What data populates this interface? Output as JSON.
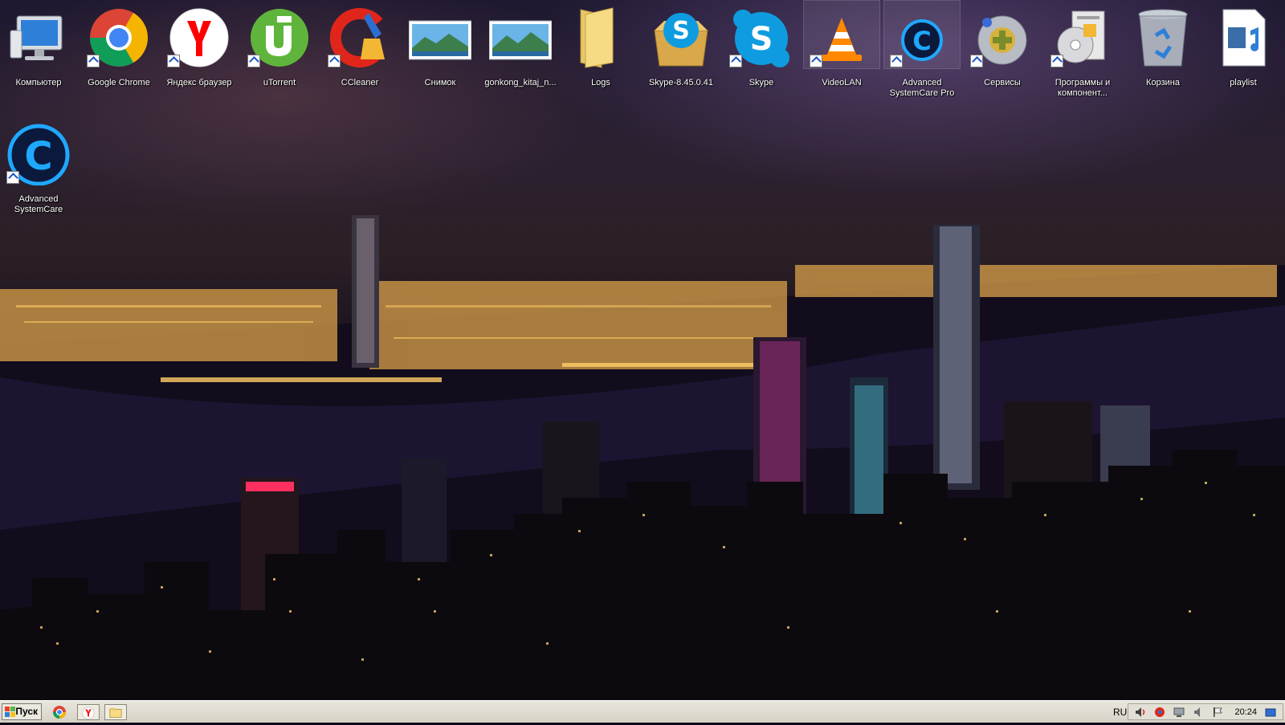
{
  "desktop": {
    "icons": [
      {
        "label": "Компьютер",
        "icon": "computer-icon",
        "shortcut": false
      },
      {
        "label": "Google Chrome",
        "icon": "chrome-icon",
        "shortcut": true
      },
      {
        "label": "Яндекс браузер",
        "icon": "yandex-browser-icon",
        "shortcut": true
      },
      {
        "label": "uTorrent",
        "icon": "utorrent-icon",
        "shortcut": true
      },
      {
        "label": "CCleaner",
        "icon": "ccleaner-icon",
        "shortcut": true
      },
      {
        "label": "Снимок",
        "icon": "image-file-icon",
        "shortcut": false
      },
      {
        "label": "gonkong_kitaj_n...",
        "icon": "image-file-icon",
        "shortcut": false
      },
      {
        "label": "Logs",
        "icon": "folder-icon",
        "shortcut": false
      },
      {
        "label": "Skype-8.45.0.41",
        "icon": "skype-installer-icon",
        "shortcut": false
      },
      {
        "label": "Skype",
        "icon": "skype-icon",
        "shortcut": true
      },
      {
        "label": "VideoLAN",
        "icon": "vlc-icon",
        "shortcut": true
      },
      {
        "label": "Advanced SystemCare Pro",
        "icon": "advanced-systemcare-icon",
        "shortcut": true
      },
      {
        "label": "Сервисы",
        "icon": "services-icon",
        "shortcut": true
      },
      {
        "label": "Программы и компонент...",
        "icon": "programs-components-icon",
        "shortcut": true
      },
      {
        "label": "Корзина",
        "icon": "recycle-bin-icon",
        "shortcut": false
      },
      {
        "label": "playlist",
        "icon": "playlist-file-icon",
        "shortcut": false
      },
      {
        "label": "Advanced SystemCare",
        "icon": "advanced-systemcare-icon",
        "shortcut": true
      }
    ]
  },
  "taskbar": {
    "start_label": "Пуск",
    "quick_launch": [
      "chrome-icon",
      "yandex-browser-icon",
      "explorer-icon"
    ],
    "language": "RU",
    "tray_icons": [
      "volume-icon",
      "network-icon",
      "monitor-icon",
      "speaker-icon",
      "flag-icon"
    ],
    "clock": "20:24"
  },
  "colors": {
    "taskbar_bg": "#d6d2c6",
    "label_text": "#ffffff",
    "skype_blue": "#0f9bdf",
    "chrome_red": "#db4437",
    "chrome_green": "#0f9d58",
    "chrome_yellow": "#f4b400",
    "utorrent_green": "#5fb53b",
    "yandex_red": "#ff0000",
    "asc_blue": "#1fa8ff"
  }
}
